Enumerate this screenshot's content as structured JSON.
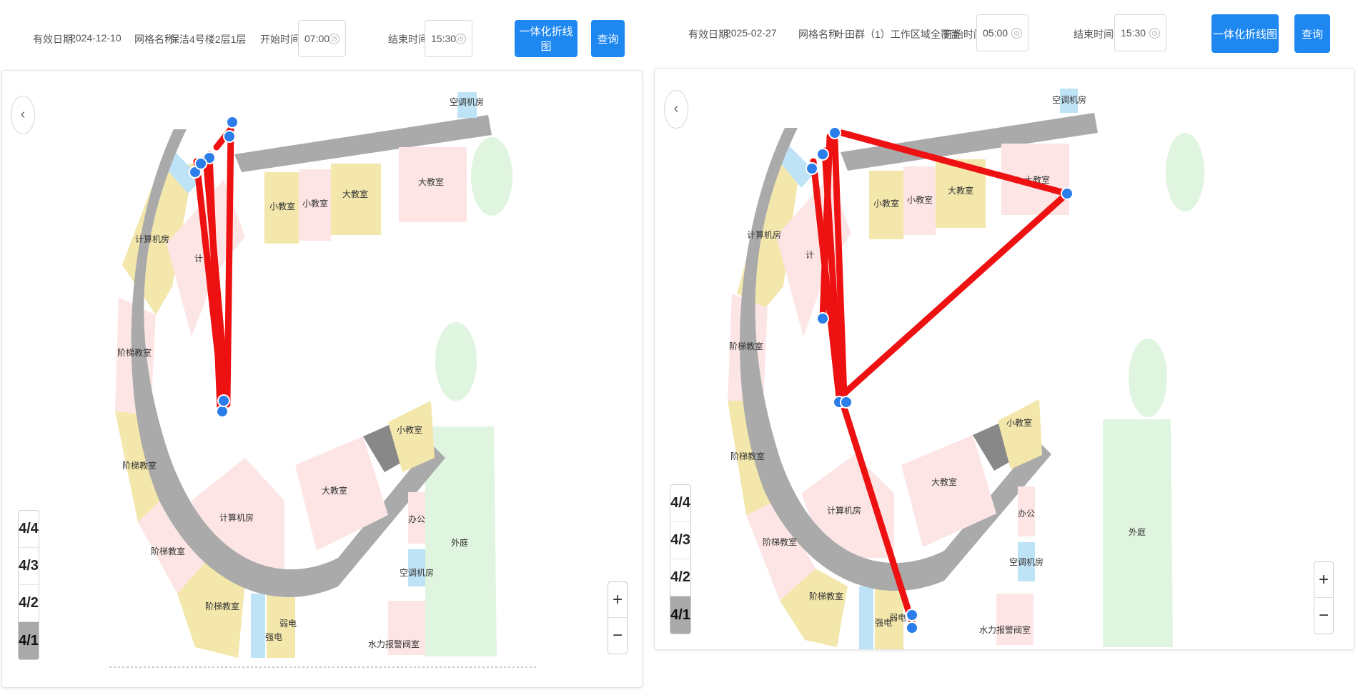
{
  "colors": {
    "accent": "#1e88f0",
    "route": "#ee1111",
    "marker": "#2b7de9",
    "room_pink": "#fde5e5",
    "room_yellow": "#f3e7ac",
    "room_blue": "#bfe3f6",
    "room_green": "#dff5df",
    "corridor": "#aaaaaa"
  },
  "icons": {
    "back": "chevron-left-icon",
    "time": "clock-icon",
    "zoom_in": "plus-icon",
    "zoom_out": "minus-icon"
  },
  "left": {
    "date_label": "有效日期:",
    "date_value": "2024-12-10",
    "grid_label": "网格名称:",
    "grid_value": "保洁4号楼2层1层",
    "start_label": "开始时间:",
    "start_value": "07:00",
    "end_label": "结束时间:",
    "end_value": "15:30",
    "chart_btn": "一体化折线图",
    "query_btn": "查询",
    "back": "‹",
    "floors": [
      "4/4",
      "4/3",
      "4/2",
      "4/1"
    ],
    "active_floor": "4/1",
    "zoom_in": "+",
    "zoom_out": "−"
  },
  "right": {
    "date_label": "有效日期:",
    "date_value": "2025-02-27",
    "grid_label": "网格名称:",
    "grid_value": "叶田群（1）工作区域全覆盖",
    "start_label": "开始时间:",
    "start_value": "05:00",
    "end_label": "结束时间:",
    "end_value": "15:30",
    "chart_btn": "一体化折线图",
    "query_btn": "查询",
    "back": "‹",
    "floors": [
      "4/4",
      "4/3",
      "4/2",
      "4/1"
    ],
    "active_floor": "4/1",
    "zoom_in": "+",
    "zoom_out": "−"
  },
  "rooms": {
    "small_class": "小教室",
    "big_class": "大教室",
    "computer_room": "计算机房",
    "computer_short": "计",
    "lecture_room": "阶梯教室",
    "aircon_room": "空调机房",
    "courtyard": "外庭",
    "office": "办公",
    "water_pump": "水力报警阀室",
    "weak_current": "弱电",
    "strong_current": "强电"
  }
}
